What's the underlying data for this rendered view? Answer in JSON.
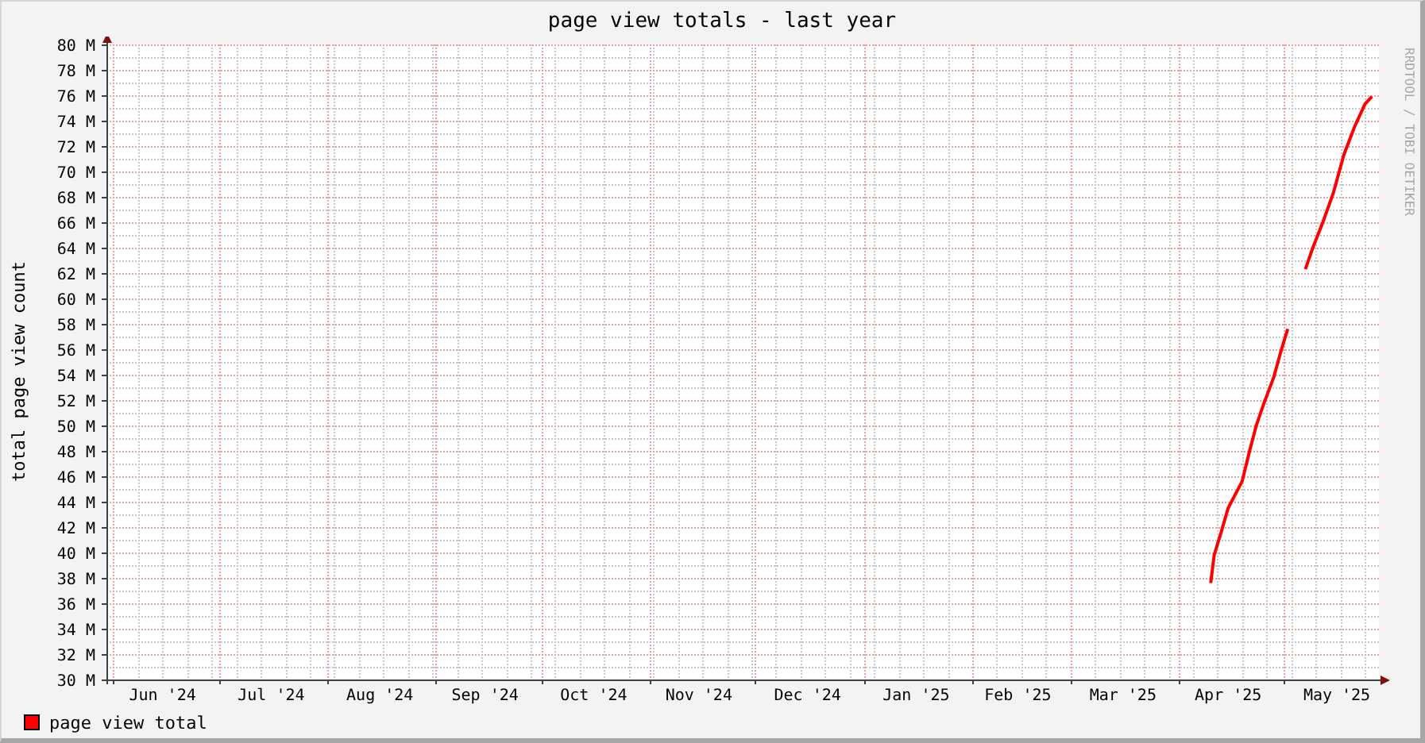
{
  "graph": {
    "credit": "RRDTOOL / TOBI OETIKER",
    "chart_data": {
      "type": "line",
      "grid": true,
      "title": "page view totals - last year",
      "ylabel": "total page view count",
      "xlim": [
        "2024-05-30",
        "2025-05-28"
      ],
      "ylim": [
        30,
        80
      ],
      "xticks": [
        {
          "value": "2024-06-15",
          "label": "Jun '24"
        },
        {
          "value": "2024-07-16",
          "label": "Jul '24"
        },
        {
          "value": "2024-08-16",
          "label": "Aug '24"
        },
        {
          "value": "2024-09-15",
          "label": "Sep '24"
        },
        {
          "value": "2024-10-16",
          "label": "Oct '24"
        },
        {
          "value": "2024-11-15",
          "label": "Nov '24"
        },
        {
          "value": "2024-12-16",
          "label": "Dec '24"
        },
        {
          "value": "2025-01-16",
          "label": "Jan '25"
        },
        {
          "value": "2025-02-14",
          "label": "Feb '25"
        },
        {
          "value": "2025-03-16",
          "label": "Mar '25"
        },
        {
          "value": "2025-04-15",
          "label": "Apr '25"
        },
        {
          "value": "2025-05-16",
          "label": "May '25"
        }
      ],
      "yticks": [
        {
          "value": 30,
          "label": "30 M"
        },
        {
          "value": 32,
          "label": "32 M"
        },
        {
          "value": 34,
          "label": "34 M"
        },
        {
          "value": 36,
          "label": "36 M"
        },
        {
          "value": 38,
          "label": "38 M"
        },
        {
          "value": 40,
          "label": "40 M"
        },
        {
          "value": 42,
          "label": "42 M"
        },
        {
          "value": 44,
          "label": "44 M"
        },
        {
          "value": 46,
          "label": "46 M"
        },
        {
          "value": 48,
          "label": "48 M"
        },
        {
          "value": 50,
          "label": "50 M"
        },
        {
          "value": 52,
          "label": "52 M"
        },
        {
          "value": 54,
          "label": "54 M"
        },
        {
          "value": 56,
          "label": "56 M"
        },
        {
          "value": 58,
          "label": "58 M"
        },
        {
          "value": 60,
          "label": "60 M"
        },
        {
          "value": 62,
          "label": "62 M"
        },
        {
          "value": 64,
          "label": "64 M"
        },
        {
          "value": 66,
          "label": "66 M"
        },
        {
          "value": 68,
          "label": "68 M"
        },
        {
          "value": 70,
          "label": "70 M"
        },
        {
          "value": 72,
          "label": "72 M"
        },
        {
          "value": 74,
          "label": "74 M"
        },
        {
          "value": 76,
          "label": "76 M"
        },
        {
          "value": 78,
          "label": "78 M"
        },
        {
          "value": 80,
          "label": "80 M"
        }
      ],
      "x": [
        "2025-04-10",
        "2025-04-11",
        "2025-04-13",
        "2025-04-15",
        "2025-04-19",
        "2025-04-21",
        "2025-04-23",
        "2025-04-25",
        "2025-04-28",
        "2025-04-30",
        "2025-05-02",
        "2025-05-07",
        "2025-05-09",
        "2025-05-12",
        "2025-05-15",
        "2025-05-18",
        "2025-05-21",
        "2025-05-24",
        "2025-05-26"
      ],
      "series": [
        {
          "name": "page view total",
          "color": "#ff0000",
          "values": [
            37.6,
            39.8,
            41.6,
            43.5,
            45.6,
            47.9,
            50,
            51.6,
            53.8,
            55.8,
            57.6,
            62.3,
            63.9,
            66,
            68.3,
            71.3,
            73.5,
            75.3,
            75.9
          ]
        }
      ]
    }
  }
}
